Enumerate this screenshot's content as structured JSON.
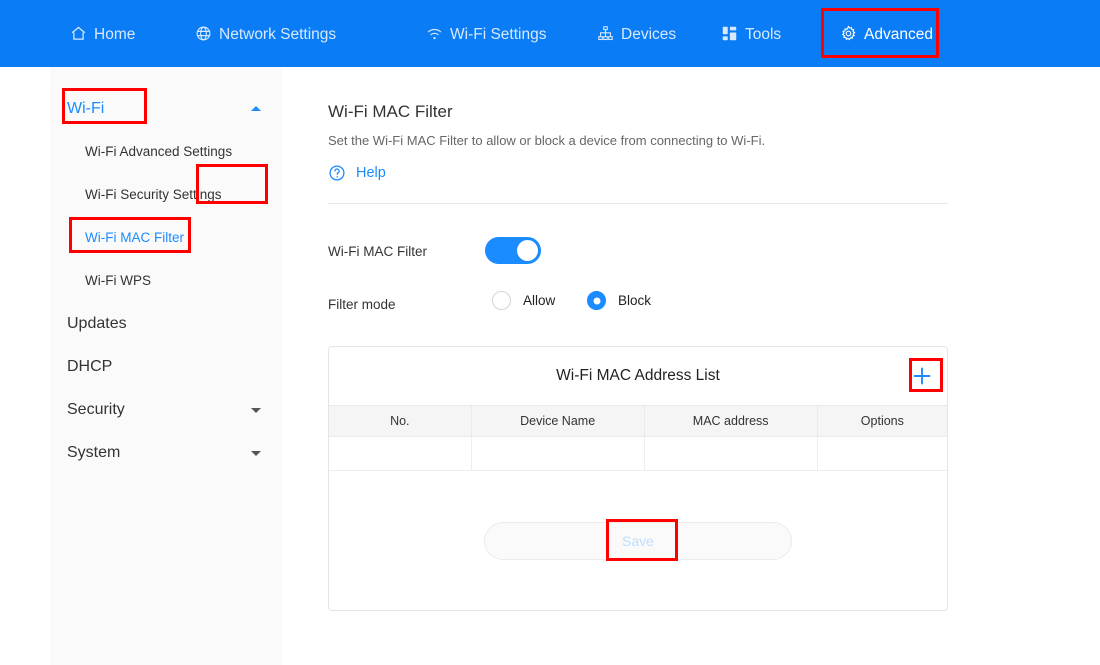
{
  "topnav": {
    "items": [
      {
        "id": "home",
        "label": "Home",
        "icon": "home-icon",
        "active": false
      },
      {
        "id": "network",
        "label": "Network Settings",
        "icon": "globe-icon",
        "active": false
      },
      {
        "id": "wifi",
        "label": "Wi-Fi Settings",
        "icon": "wifi-icon",
        "active": false
      },
      {
        "id": "devices",
        "label": "Devices",
        "icon": "sitemap-icon",
        "active": false
      },
      {
        "id": "tools",
        "label": "Tools",
        "icon": "grid-icon",
        "active": false
      },
      {
        "id": "advanced",
        "label": "Advanced",
        "icon": "gear-icon",
        "active": true
      }
    ],
    "bar_color": "#0a7cf5",
    "highlight_color": "#fe0000"
  },
  "sidebar": {
    "groups": [
      {
        "id": "wifi",
        "label": "Wi-Fi",
        "expanded": true,
        "caret": "up",
        "current": true
      },
      {
        "id": "updates",
        "label": "Updates",
        "expanded": false,
        "caret": "none",
        "current": false
      },
      {
        "id": "dhcp",
        "label": "DHCP",
        "expanded": false,
        "caret": "none",
        "current": false
      },
      {
        "id": "security",
        "label": "Security",
        "expanded": false,
        "caret": "down",
        "current": false
      },
      {
        "id": "system",
        "label": "System",
        "expanded": false,
        "caret": "down",
        "current": false
      }
    ],
    "wifi_children": [
      {
        "id": "wifi-advanced",
        "label": "Wi-Fi Advanced Settings",
        "current": false
      },
      {
        "id": "wifi-security",
        "label": "Wi-Fi Security Settings",
        "current": false
      },
      {
        "id": "wifi-mac",
        "label": "Wi-Fi MAC Filter",
        "current": true
      },
      {
        "id": "wifi-wps",
        "label": "Wi-Fi WPS",
        "current": false
      }
    ],
    "accent_color": "#1a8cff"
  },
  "main": {
    "title": "Wi-Fi MAC Filter",
    "description": "Set the Wi-Fi MAC Filter to allow or block a device from connecting to Wi-Fi.",
    "help_label": "Help",
    "help_icon": "question-circle-icon",
    "mac_filter": {
      "label": "Wi-Fi MAC Filter",
      "enabled": true
    },
    "filter_mode": {
      "label": "Filter mode",
      "options": [
        {
          "id": "allow",
          "label": "Allow",
          "selected": false
        },
        {
          "id": "block",
          "label": "Block",
          "selected": true
        }
      ]
    },
    "table": {
      "title": "Wi-Fi MAC Address List",
      "add_icon": "plus-icon",
      "columns": [
        "No.",
        "Device Name",
        "MAC address",
        "Options"
      ],
      "rows": [
        [
          "",
          "",
          "",
          ""
        ]
      ]
    },
    "save_label": "Save",
    "save_disabled": true
  }
}
